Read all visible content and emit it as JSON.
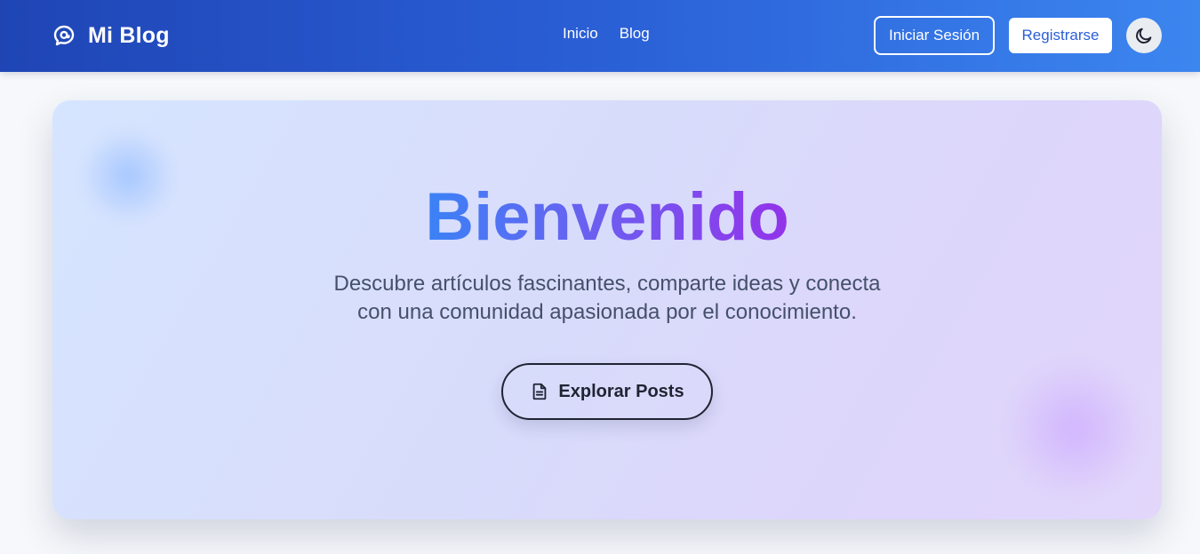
{
  "navbar": {
    "brand": "Mi Blog",
    "brand_icon": "chat-bubble-icon",
    "links": [
      "Inicio",
      "Blog"
    ],
    "login_label": "Iniciar Sesión",
    "register_label": "Registrarse",
    "theme_icon": "moon-icon",
    "colors": {
      "gradient_start": "#1f45b5",
      "gradient_end": "#3c86f0"
    }
  },
  "hero": {
    "title": "Bienvenido",
    "subtitle_line1": "Descubre artículos fascinantes, comparte ideas y conecta",
    "subtitle_line2": "con una comunidad apasionada por el conocimiento.",
    "cta_label": "Explorar Posts",
    "cta_icon": "document-icon",
    "colors": {
      "title_start": "#3b82f6",
      "title_end": "#9333ea",
      "subtitle": "#45506a"
    }
  }
}
